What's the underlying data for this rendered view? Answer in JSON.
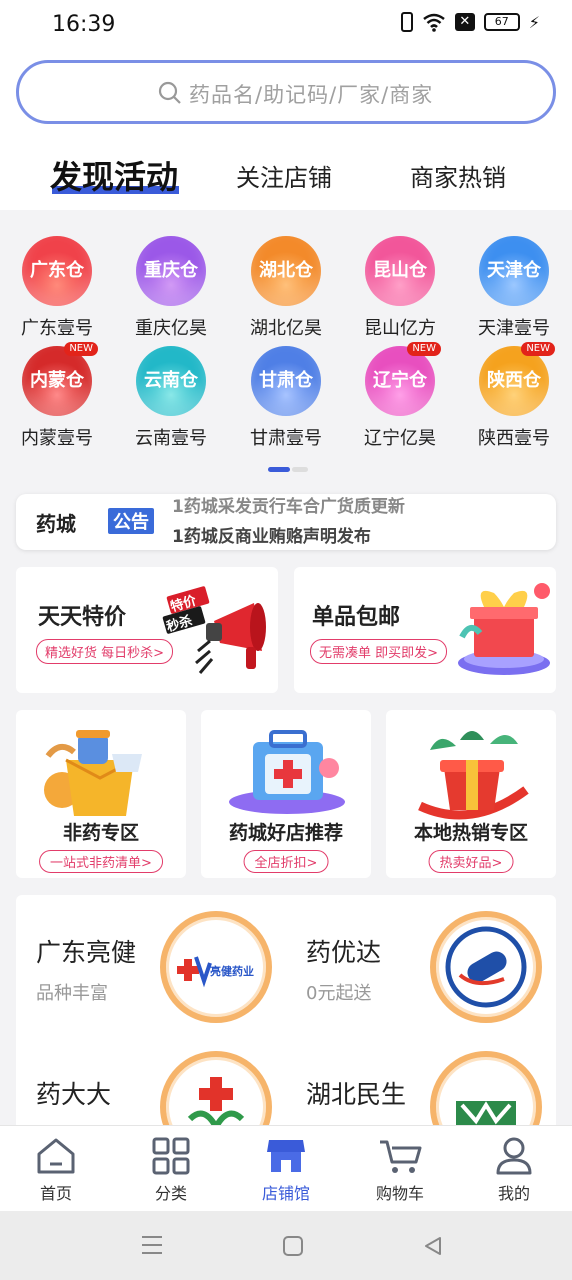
{
  "status": {
    "time": "16:39",
    "battery": "67"
  },
  "search": {
    "placeholder": "药品名/助记码/厂家/商家"
  },
  "tabs": [
    {
      "label": "发现活动",
      "active": true
    },
    {
      "label": "关注店铺",
      "active": false
    },
    {
      "label": "商家热销",
      "active": false
    }
  ],
  "warehouses": [
    {
      "circle": "广东仓",
      "label": "广东壹号",
      "color": "#f0424a",
      "new": false
    },
    {
      "circle": "重庆仓",
      "label": "重庆亿昊",
      "color": "#9b58e8",
      "new": false
    },
    {
      "circle": "湖北仓",
      "label": "湖北亿昊",
      "color": "#f38a2a",
      "new": false
    },
    {
      "circle": "昆山仓",
      "label": "昆山亿方",
      "color": "#f2569a",
      "new": false
    },
    {
      "circle": "天津仓",
      "label": "天津壹号",
      "color": "#3d8ff0",
      "new": false
    },
    {
      "circle": "内蒙仓",
      "label": "内蒙壹号",
      "color": "#d52a2a",
      "new": true
    },
    {
      "circle": "云南仓",
      "label": "云南壹号",
      "color": "#22b8c8",
      "new": false
    },
    {
      "circle": "甘肃仓",
      "label": "甘肃壹号",
      "color": "#4f7fe6",
      "new": false
    },
    {
      "circle": "辽宁仓",
      "label": "辽宁亿昊",
      "color": "#e84fbf",
      "new": true
    },
    {
      "circle": "陕西仓",
      "label": "陕西壹号",
      "color": "#f5a21e",
      "new": true
    }
  ],
  "new_badge": "NEW",
  "notice": {
    "brand": "药城",
    "tag": "公告",
    "lines": [
      "1药城采发贡行车合广货质更新",
      "1药城反商业贿赂声明发布"
    ]
  },
  "promos": [
    {
      "title": "天天特价",
      "sub": "精选好货 每日秒杀>",
      "tag1": "特价",
      "tag2": "秒杀"
    },
    {
      "title": "单品包邮",
      "sub": "无需凑单 即买即发>"
    }
  ],
  "zones": [
    {
      "title": "非药专区",
      "sub": "一站式非药清单>"
    },
    {
      "title": "药城好店推荐",
      "sub": "全店折扣>"
    },
    {
      "title": "本地热销专区",
      "sub": "热卖好品>"
    }
  ],
  "stores": [
    {
      "name": "广东亮健",
      "desc": "品种丰富",
      "logo_text": "亮健药业"
    },
    {
      "name": "药优达",
      "desc": "0元起送"
    },
    {
      "name": "药大大",
      "desc": ""
    },
    {
      "name": "湖北民生",
      "desc": ""
    }
  ],
  "tabbar": [
    {
      "label": "首页",
      "icon": "home-icon",
      "active": false
    },
    {
      "label": "分类",
      "icon": "grid-icon",
      "active": false
    },
    {
      "label": "店铺馆",
      "icon": "store-icon",
      "active": true
    },
    {
      "label": "购物车",
      "icon": "cart-icon",
      "active": false
    },
    {
      "label": "我的",
      "icon": "user-icon",
      "active": false
    }
  ]
}
